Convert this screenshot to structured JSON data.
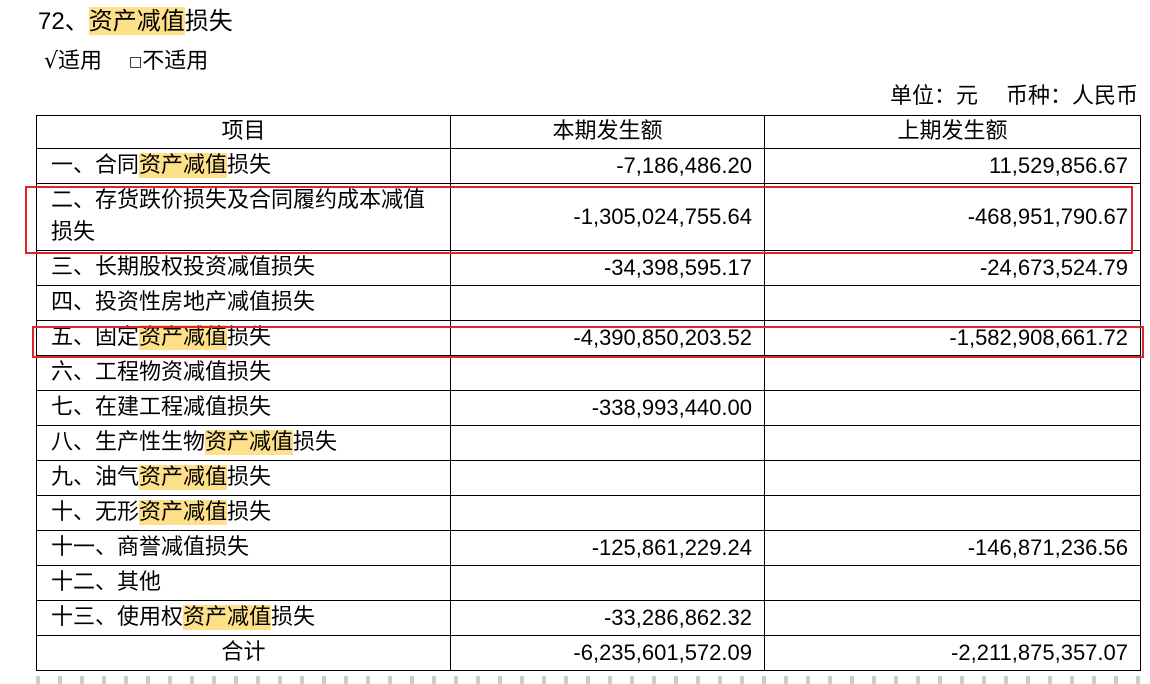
{
  "section": {
    "number": "72、",
    "title_highlight": "资产减值",
    "title_rest": "损失"
  },
  "applicability": {
    "applicable": "√适用",
    "box": "□",
    "not_applicable": "不适用"
  },
  "unit": {
    "unit_text": "单位：元",
    "currency_text": "币种：人民币"
  },
  "table": {
    "headers": [
      "项目",
      "本期发生额",
      "上期发生额"
    ],
    "rows": [
      {
        "pre": "一、合同",
        "hl": "资产减值",
        "post": "损失",
        "current": "-7,186,486.20",
        "previous": "11,529,856.67"
      },
      {
        "pre": "二、存货跌价损失及合同履约成本减值损失",
        "hl": "",
        "post": "",
        "current": "-1,305,024,755.64",
        "previous": "-468,951,790.67"
      },
      {
        "pre": "三、长期股权投资减值损失",
        "hl": "",
        "post": "",
        "current": "-34,398,595.17",
        "previous": "-24,673,524.79"
      },
      {
        "pre": "四、投资性房地产减值损失",
        "hl": "",
        "post": "",
        "current": "",
        "previous": ""
      },
      {
        "pre": "五、固定",
        "hl": "资产减值",
        "post": "损失",
        "current": "-4,390,850,203.52",
        "previous": "-1,582,908,661.72"
      },
      {
        "pre": "六、工程物资减值损失",
        "hl": "",
        "post": "",
        "current": "",
        "previous": ""
      },
      {
        "pre": "七、在建工程减值损失",
        "hl": "",
        "post": "",
        "current": "-338,993,440.00",
        "previous": ""
      },
      {
        "pre": "八、生产性生物",
        "hl": "资产减值",
        "post": "损失",
        "current": "",
        "previous": ""
      },
      {
        "pre": "九、油气",
        "hl": "资产减值",
        "post": "损失",
        "current": "",
        "previous": ""
      },
      {
        "pre": "十、无形",
        "hl": "资产减值",
        "post": "损失",
        "current": "",
        "previous": ""
      },
      {
        "pre": "十一、商誉减值损失",
        "hl": "",
        "post": "",
        "current": "-125,861,229.24",
        "previous": "-146,871,236.56"
      },
      {
        "pre": "十二、其他",
        "hl": "",
        "post": "",
        "current": "",
        "previous": ""
      },
      {
        "pre": "十三、使用权",
        "hl": "资产减值",
        "post": "损失",
        "current": "-33,286,862.32",
        "previous": ""
      }
    ],
    "total": {
      "label": "合计",
      "current": "-6,235,601,572.09",
      "previous": "-2,211,875,357.07"
    }
  },
  "colors": {
    "highlight": "#ffe08a",
    "annotation_box": "#e0252a"
  }
}
